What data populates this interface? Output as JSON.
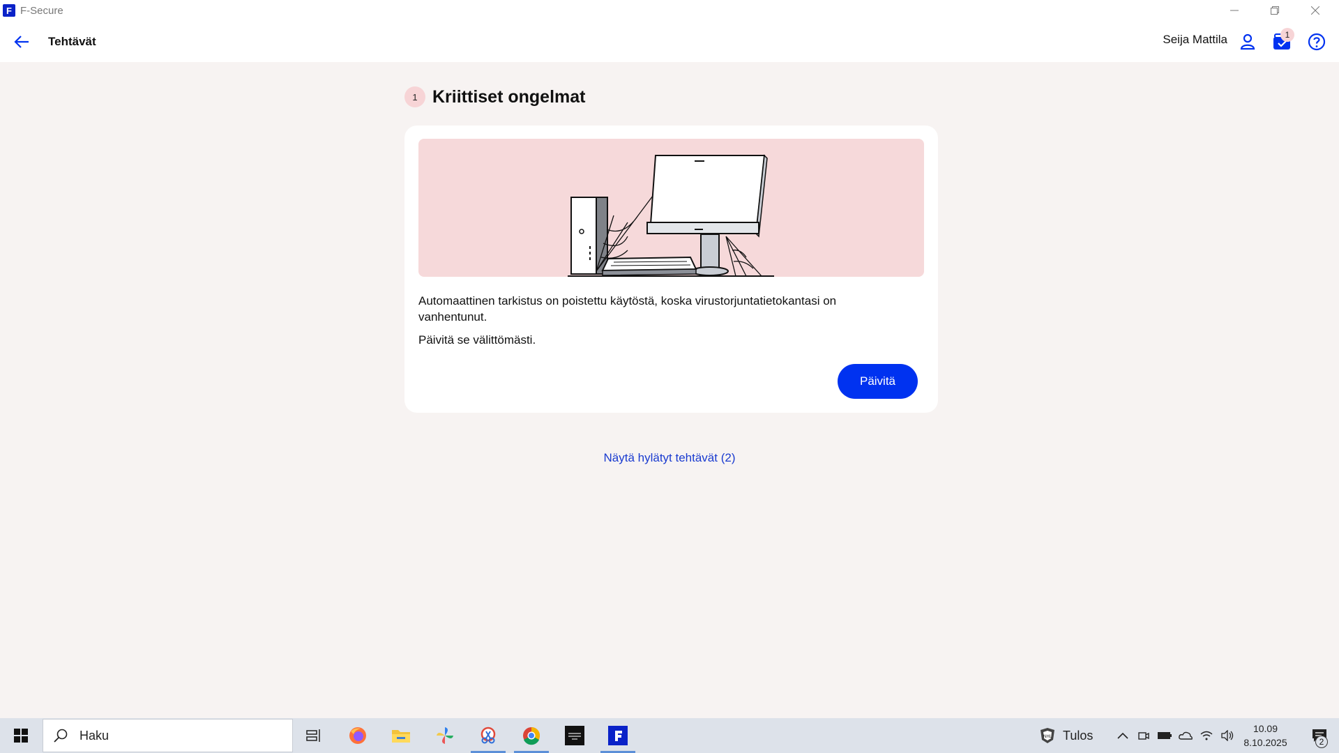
{
  "titlebar": {
    "app_title": "F-Secure",
    "logo_letter": "F"
  },
  "header": {
    "page_title": "Tehtävät",
    "user_name": "Seija Mattila",
    "tasks_badge": "1"
  },
  "main": {
    "section_count": "1",
    "section_title": "Kriittiset ongelmat",
    "card": {
      "text_primary": "Automaattinen tarkistus on poistettu käytöstä, koska virustorjuntatietokantasi on vanhentunut.",
      "text_secondary": "Päivitä se välittömästi.",
      "button_label": "Päivitä"
    },
    "dismissed_link": "Näytä hylätyt tehtävät (2)"
  },
  "taskbar": {
    "search_placeholder": "Haku",
    "weather_text": "Tulos",
    "clock_time": "10.09",
    "clock_date": "8.10.2025",
    "notification_count": "2",
    "apps": [
      "task-view",
      "firefox",
      "file-explorer",
      "photos",
      "snipping-tool",
      "chrome",
      "news-app",
      "f-secure"
    ]
  },
  "colors": {
    "accent": "#0032f0",
    "badge": "#f7d4d6",
    "link": "#1a3bd0",
    "background": "#f7f3f2"
  }
}
